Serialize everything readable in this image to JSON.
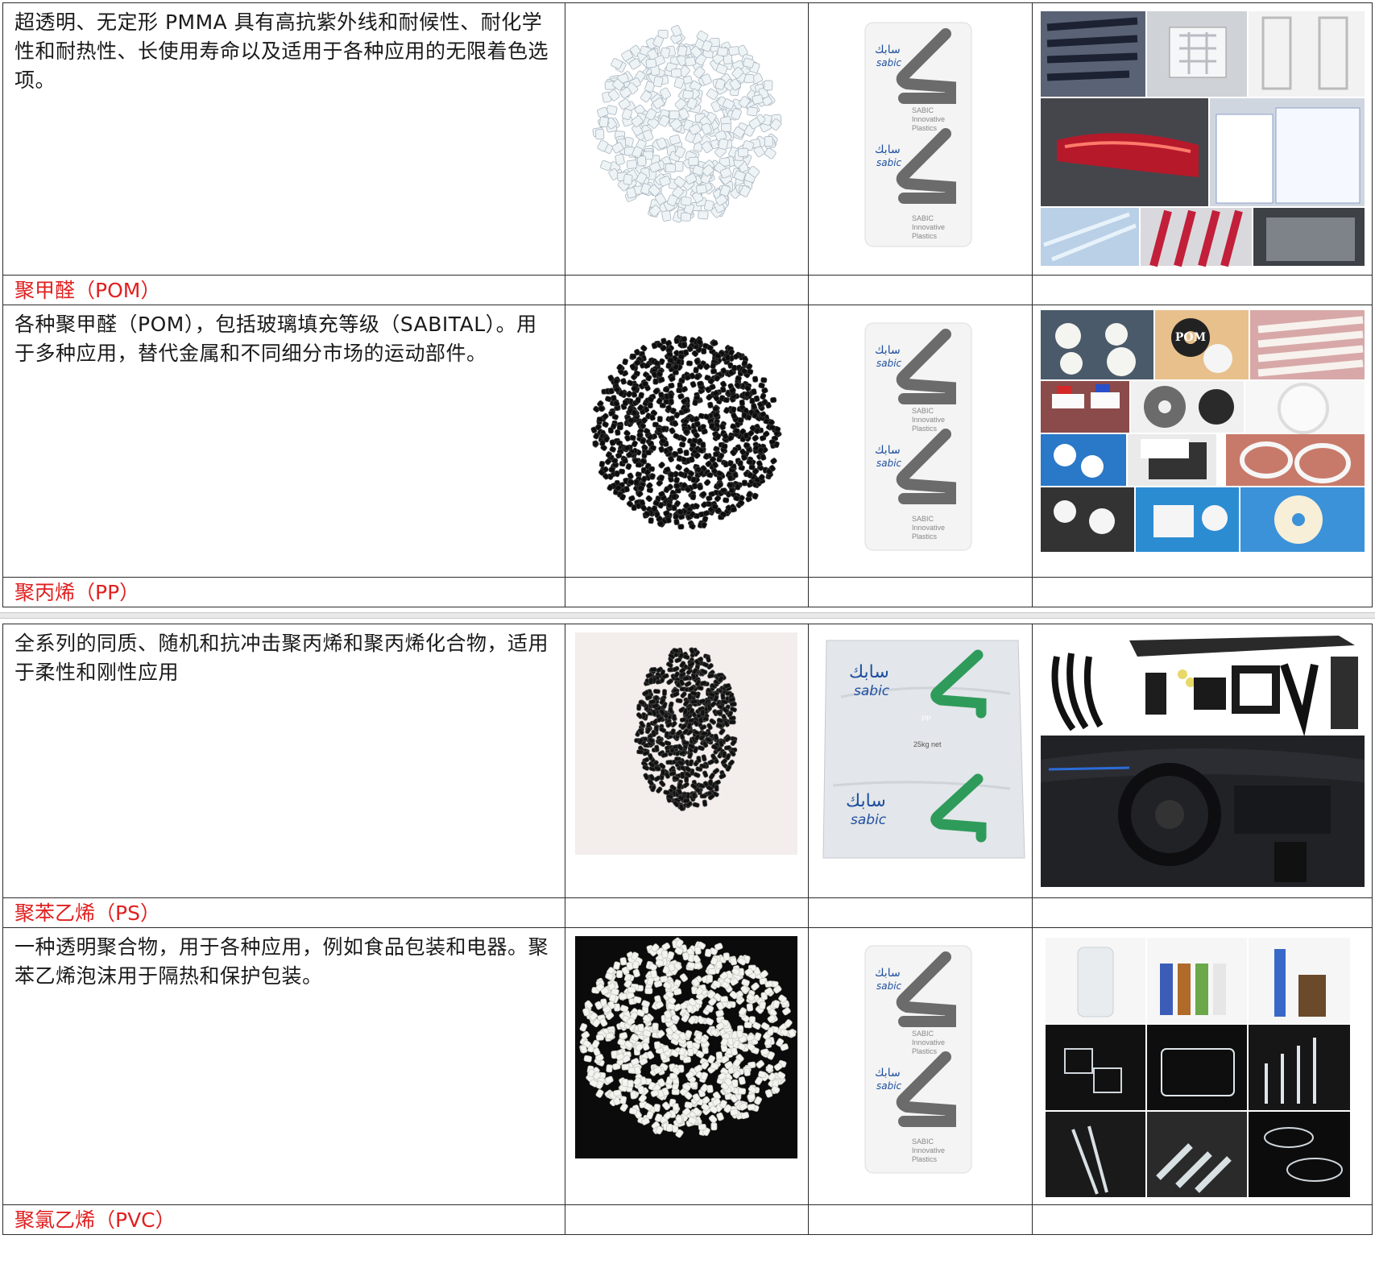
{
  "rows": [
    {
      "description": "超透明、无定形 PMMA 具有高抗紫外线和耐候性、耐化学性和耐热性、长使用寿命以及适用于各种应用的无限着色选项。",
      "next_heading": "聚甲醛（POM）"
    },
    {
      "description": "各种聚甲醛（POM），包括玻璃填充等级（SABITAL）。用于多种应用，替代金属和不同细分市场的运动部件。",
      "next_heading": "聚丙烯（PP）"
    },
    {
      "description": "全系列的同质、随机和抗冲击聚丙烯和聚丙烯化合物，适用于柔性和刚性应用",
      "next_heading": "聚苯乙烯（PS）"
    },
    {
      "description": "一种透明聚合物，用于各种应用，例如食品包装和电器。聚苯乙烯泡沫用于隔热和保护包装。",
      "next_heading": "聚氯乙烯（PVC）"
    }
  ],
  "bag": {
    "brand_arabic": "سابك",
    "brand_latin": "sabic",
    "caption_lines": [
      "SABIC",
      "Innovative",
      "Plastics"
    ]
  },
  "pp_bag": {
    "grade": "PP",
    "net_weight": "25kg net"
  },
  "pom_label": "POM"
}
